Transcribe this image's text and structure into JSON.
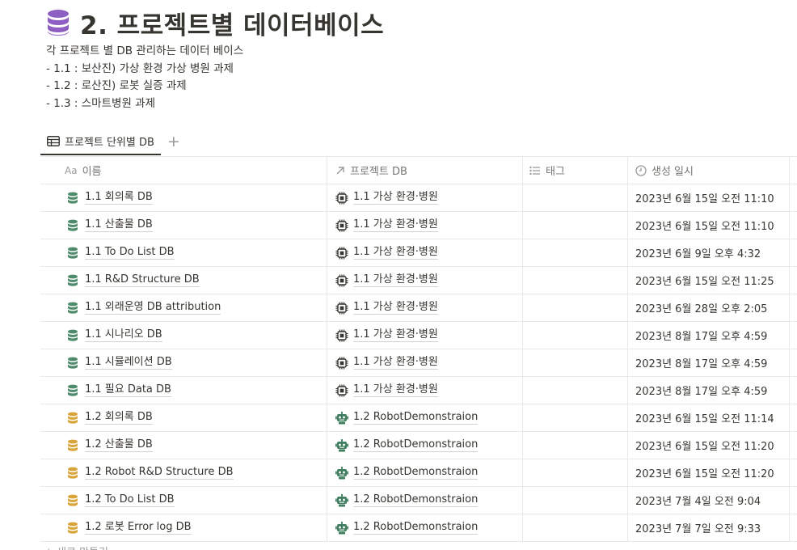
{
  "page": {
    "title": "2. 프로젝트별 데이터베이스",
    "title_icon": "database-icon",
    "accent_color": "#8e5fc3"
  },
  "description": {
    "lines": [
      "각 프로젝트 별 DB 관리하는 데이터 베이스",
      "- 1.1 : 보산진) 가상 환경 가상 병원 과제",
      "- 1.2 : 로산진) 로봇 실증 과제",
      "- 1.3 : 스마트병원 과제"
    ]
  },
  "view_tabs": {
    "active_label": "프로젝트 단위별 DB",
    "add_label": "+"
  },
  "table": {
    "headers": {
      "name_prefix": "Aa",
      "name": "이름",
      "project": "프로젝트 DB",
      "tags": "태그",
      "created": "생성 일시"
    },
    "colors": {
      "db_green": "#4e8b6b",
      "db_orange": "#d9a53a",
      "robot_green": "#3f7f5f"
    },
    "rows": [
      {
        "name": "1.1 회의록 DB",
        "db_color": "green",
        "project": "1.1 가상 환경·병원",
        "project_icon": "chip-icon",
        "tags": "",
        "created": "2023년 6월 15일 오전 11:10"
      },
      {
        "name": "1.1 산출물 DB",
        "db_color": "green",
        "project": "1.1 가상 환경·병원",
        "project_icon": "chip-icon",
        "tags": "",
        "created": "2023년 6월 15일 오전 11:10"
      },
      {
        "name": "1.1 To Do List DB",
        "db_color": "green",
        "project": "1.1 가상 환경·병원",
        "project_icon": "chip-icon",
        "tags": "",
        "created": "2023년 6월 9일 오후 4:32"
      },
      {
        "name": "1.1 R&D Structure DB",
        "db_color": "green",
        "project": "1.1 가상 환경·병원",
        "project_icon": "chip-icon",
        "tags": "",
        "created": "2023년 6월 15일 오전 11:25"
      },
      {
        "name": "1.1 외래운영 DB attribution",
        "db_color": "green",
        "project": "1.1 가상 환경·병원",
        "project_icon": "chip-icon",
        "tags": "",
        "created": "2023년 6월 28일 오후 2:05"
      },
      {
        "name": "1.1 시나리오 DB",
        "db_color": "green",
        "project": "1.1 가상 환경·병원",
        "project_icon": "chip-icon",
        "tags": "",
        "created": "2023년 8월 17일 오후 4:59"
      },
      {
        "name": "1.1 시뮬레이션 DB",
        "db_color": "green",
        "project": "1.1 가상 환경·병원",
        "project_icon": "chip-icon",
        "tags": "",
        "created": "2023년 8월 17일 오후 4:59"
      },
      {
        "name": "1.1 필요 Data DB",
        "db_color": "green",
        "project": "1.1 가상 환경·병원",
        "project_icon": "chip-icon",
        "tags": "",
        "created": "2023년 8월 17일 오후 4:59"
      },
      {
        "name": "1.2 회의록 DB",
        "db_color": "orange",
        "project": "1.2 RobotDemonstraion",
        "project_icon": "robot-icon",
        "tags": "",
        "created": "2023년 6월 15일 오전 11:14"
      },
      {
        "name": "1.2 산출물 DB",
        "db_color": "orange",
        "project": "1.2 RobotDemonstraion",
        "project_icon": "robot-icon",
        "tags": "",
        "created": "2023년 6월 15일 오전 11:20"
      },
      {
        "name": "1.2 Robot R&D Structure DB",
        "db_color": "orange",
        "project": "1.2 RobotDemonstraion",
        "project_icon": "robot-icon",
        "tags": "",
        "created": "2023년 6월 15일 오전 11:20"
      },
      {
        "name": "1.2 To Do List DB",
        "db_color": "orange",
        "project": "1.2 RobotDemonstraion",
        "project_icon": "robot-icon",
        "tags": "",
        "created": "2023년 7월 4일 오전 9:04"
      },
      {
        "name": "1.2 로봇 Error log DB",
        "db_color": "orange",
        "project": "1.2 RobotDemonstraion",
        "project_icon": "robot-icon",
        "tags": "",
        "created": "2023년 7월 7일 오전 9:33"
      }
    ]
  },
  "footer": {
    "new_label": "+ 새로 만들기"
  }
}
